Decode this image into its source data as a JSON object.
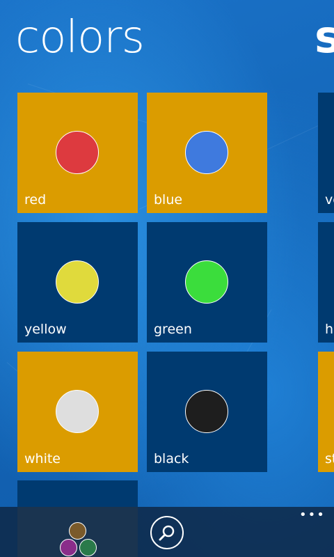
{
  "page": {
    "title": "colors",
    "next_title_partial": "s"
  },
  "tiles": [
    {
      "label": "red",
      "tile_color": "#db9c00",
      "dot_color": "#dd3a3f"
    },
    {
      "label": "blue",
      "tile_color": "#db9c00",
      "dot_color": "#3f7ade"
    },
    {
      "label": "yellow",
      "tile_color": "#003a70",
      "dot_color": "#e0da3c"
    },
    {
      "label": "green",
      "tile_color": "#003a70",
      "dot_color": "#3bdd3c"
    },
    {
      "label": "white",
      "tile_color": "#db9c00",
      "dot_color": "#dedede"
    },
    {
      "label": "black",
      "tile_color": "#003a70",
      "dot_color": "#1e1e1e"
    }
  ],
  "peek_tiles": [
    {
      "label": "ve"
    },
    {
      "label": "he"
    },
    {
      "label": "st"
    }
  ],
  "appbar": {
    "search_icon": "search-icon",
    "more_label": "•••"
  },
  "colors": {
    "accent_orange": "#db9c00",
    "accent_navy": "#003a70",
    "background_blue": "#1a72c8"
  }
}
